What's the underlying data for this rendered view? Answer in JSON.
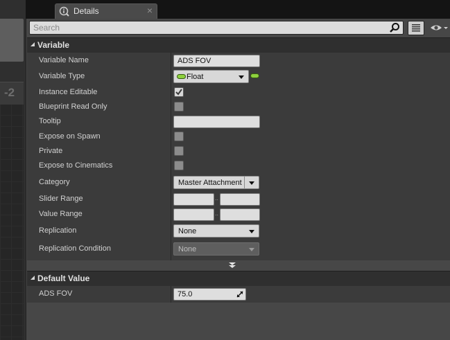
{
  "background": {
    "graph_number": "-2"
  },
  "tab": {
    "title": "Details",
    "close_glyph": "×",
    "icon": "details-icon"
  },
  "search": {
    "placeholder": "Search",
    "value": ""
  },
  "toolbar": {
    "list_view_icon": "list-icon",
    "visibility_icon": "eye-icon"
  },
  "sections": {
    "variable": {
      "title": "Variable",
      "rows": {
        "variable_name": {
          "label": "Variable Name",
          "value": "ADS FOV"
        },
        "variable_type": {
          "label": "Variable Type",
          "value": "Float"
        },
        "instance_editable": {
          "label": "Instance Editable",
          "checked": true
        },
        "blueprint_read_only": {
          "label": "Blueprint Read Only",
          "checked": false
        },
        "tooltip": {
          "label": "Tooltip",
          "value": ""
        },
        "expose_on_spawn": {
          "label": "Expose on Spawn",
          "checked": false
        },
        "private": {
          "label": "Private",
          "checked": false
        },
        "expose_to_cinematics": {
          "label": "Expose to Cinematics",
          "checked": false
        },
        "category": {
          "label": "Category",
          "value": "Master Attachment"
        },
        "slider_range": {
          "label": "Slider Range",
          "min": "",
          "max": "",
          "separator": ".."
        },
        "value_range": {
          "label": "Value Range",
          "min": "",
          "max": "",
          "separator": ".."
        },
        "replication": {
          "label": "Replication",
          "value": "None"
        },
        "replication_condition": {
          "label": "Replication Condition",
          "value": "None"
        }
      }
    },
    "default_value": {
      "title": "Default Value",
      "rows": {
        "ads_fov": {
          "label": "ADS FOV",
          "value": "75.0"
        }
      }
    }
  },
  "colors": {
    "float_pin": "#8ed13e",
    "panel": "#474747",
    "row_background": "#3b3b3b",
    "section_header": "#2f2f2f"
  }
}
